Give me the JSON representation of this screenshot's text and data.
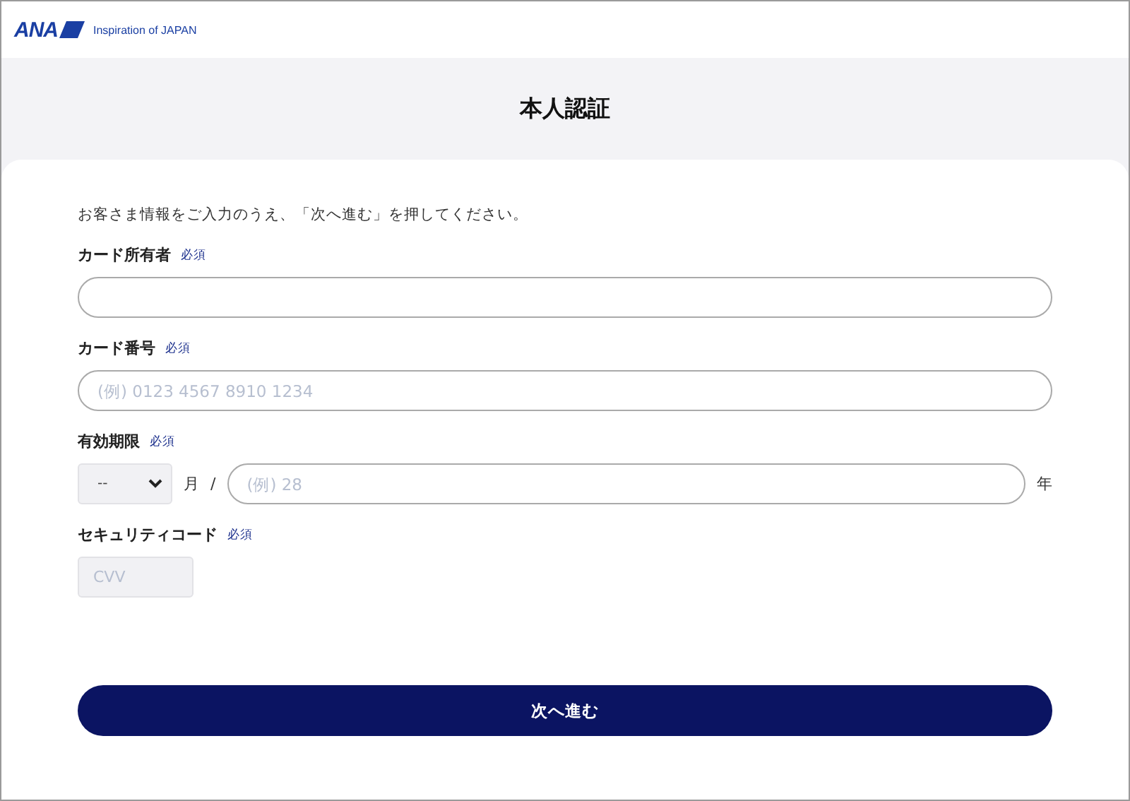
{
  "header": {
    "brand": "ANA",
    "tagline": "Inspiration of JAPAN"
  },
  "title": "本人認証",
  "intro": "お客さま情報をご入力のうえ、「次へ進む」を押してください。",
  "fields": [
    {
      "kind": "text",
      "label": "カード所有者",
      "required": "必須"
    },
    {
      "kind": "text",
      "label": "カード番号",
      "required": "必須",
      "placeholder": "(例) 0123 4567 8910 1234"
    },
    {
      "kind": "expiry",
      "label": "有効期限",
      "required": "必須",
      "month_value": "--",
      "month_unit": "月",
      "separator": "/",
      "year_placeholder": "(例) 28",
      "year_unit": "年"
    },
    {
      "kind": "cvv",
      "label": "セキュリティコード",
      "required": "必須",
      "placeholder": "CVV"
    }
  ],
  "submit": "次へ進む"
}
